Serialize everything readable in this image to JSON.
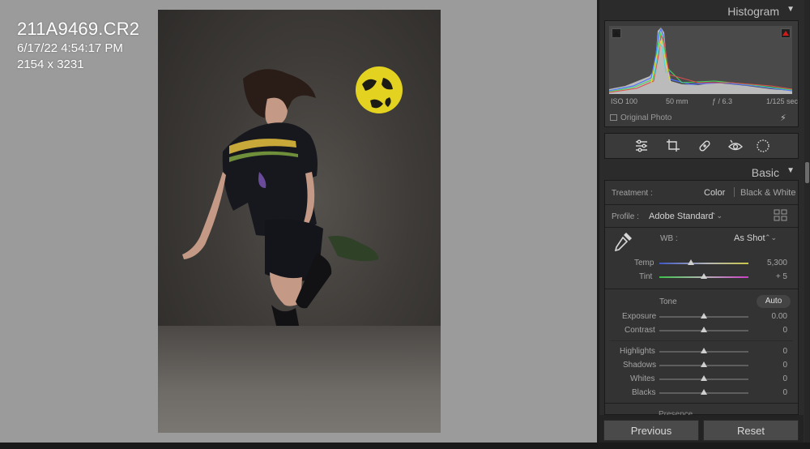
{
  "photo_info": {
    "filename": "211A9469.CR2",
    "datetime": "6/17/22 4:54:17 PM",
    "dimensions": "2154 x 3231"
  },
  "histogram": {
    "title": "Histogram",
    "iso": "ISO 100",
    "focal": "50 mm",
    "aperture": "ƒ / 6.3",
    "shutter": "1/125 sec",
    "original_photo": "Original Photo"
  },
  "basic": {
    "title": "Basic",
    "treatment_label": "Treatment :",
    "treatment_color": "Color",
    "treatment_bw": "Black & White",
    "profile_label": "Profile :",
    "profile_value": "Adobe Standard",
    "wb_label": "WB :",
    "wb_value": "As Shot",
    "temp_label": "Temp",
    "temp_value": "5,300",
    "tint_label": "Tint",
    "tint_value": "+ 5",
    "tone_label": "Tone",
    "auto_label": "Auto",
    "exposure_label": "Exposure",
    "exposure_value": "0.00",
    "contrast_label": "Contrast",
    "contrast_value": "0",
    "highlights_label": "Highlights",
    "highlights_value": "0",
    "shadows_label": "Shadows",
    "shadows_value": "0",
    "whites_label": "Whites",
    "whites_value": "0",
    "blacks_label": "Blacks",
    "blacks_value": "0",
    "presence_label": "Presence"
  },
  "sliders": {
    "temp": 0.35,
    "tint": 0.5,
    "exposure": 0.5,
    "contrast": 0.5,
    "highlights": 0.5,
    "shadows": 0.5,
    "whites": 0.5,
    "blacks": 0.5
  },
  "tools": [
    "edit-sliders-icon",
    "crop-icon",
    "healing-icon",
    "red-eye-icon",
    "masking-icon"
  ],
  "buttons": {
    "previous": "Previous",
    "reset": "Reset"
  },
  "colors": {
    "accent_red": "#d31a1a",
    "panel_bg": "#2b2b2b",
    "viewer_bg": "#9b9b9b"
  }
}
